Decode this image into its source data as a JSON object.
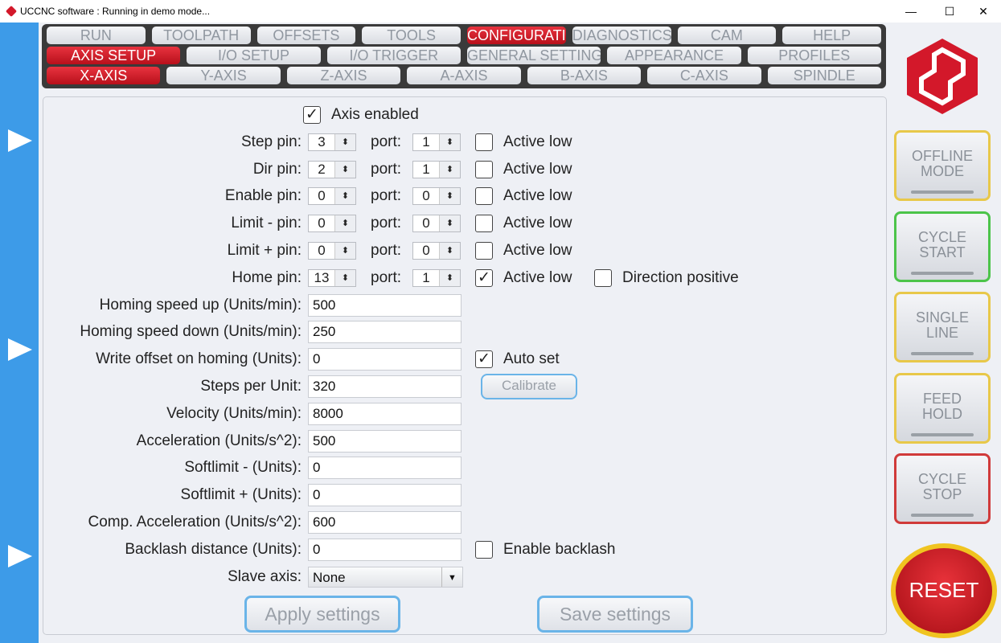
{
  "window": {
    "title": "UCCNC software : Running in demo mode...",
    "minimize": "—",
    "maximize": "☐",
    "close": "✕"
  },
  "tabs": {
    "main": [
      {
        "label": "RUN"
      },
      {
        "label": "TOOLPATH"
      },
      {
        "label": "OFFSETS"
      },
      {
        "label": "TOOLS"
      },
      {
        "label": "CONFIGURATION",
        "active": true
      },
      {
        "label": "DIAGNOSTICS"
      },
      {
        "label": "CAM"
      },
      {
        "label": "HELP"
      }
    ],
    "config": [
      {
        "label": "AXIS SETUP",
        "active": true
      },
      {
        "label": "I/O SETUP"
      },
      {
        "label": "I/O  TRIGGER"
      },
      {
        "label": "GENERAL SETTINGS"
      },
      {
        "label": "APPEARANCE"
      },
      {
        "label": "PROFILES"
      }
    ],
    "axes": [
      {
        "label": "X-AXIS",
        "active": true
      },
      {
        "label": "Y-AXIS"
      },
      {
        "label": "Z-AXIS"
      },
      {
        "label": "A-AXIS"
      },
      {
        "label": "B-AXIS"
      },
      {
        "label": "C-AXIS"
      },
      {
        "label": "SPINDLE"
      }
    ]
  },
  "form": {
    "axis_enabled": {
      "label": "Axis enabled",
      "checked": true
    },
    "port_label": "port:",
    "active_low_label": "Active low",
    "pins": [
      {
        "label": "Step pin:",
        "pin": "3",
        "port": "1",
        "active_low": false
      },
      {
        "label": "Dir pin:",
        "pin": "2",
        "port": "1",
        "active_low": false
      },
      {
        "label": "Enable pin:",
        "pin": "0",
        "port": "0",
        "active_low": false
      },
      {
        "label": "Limit - pin:",
        "pin": "0",
        "port": "0",
        "active_low": false
      },
      {
        "label": "Limit + pin:",
        "pin": "0",
        "port": "0",
        "active_low": false
      },
      {
        "label": "Home pin:",
        "pin": "13",
        "port": "1",
        "active_low": true
      }
    ],
    "direction_positive": {
      "label": "Direction positive",
      "checked": false
    },
    "fields": [
      {
        "label": "Homing speed up (Units/min):",
        "value": "500"
      },
      {
        "label": "Homing speed down (Units/min):",
        "value": "250"
      },
      {
        "label": "Write offset on homing (Units):",
        "value": "0"
      },
      {
        "label": "Steps per Unit:",
        "value": "320"
      },
      {
        "label": "Velocity (Units/min):",
        "value": "8000"
      },
      {
        "label": "Acceleration (Units/s^2):",
        "value": "500"
      },
      {
        "label": "Softlimit - (Units):",
        "value": "0"
      },
      {
        "label": "Softlimit + (Units):",
        "value": "0"
      },
      {
        "label": "Comp. Acceleration (Units/s^2):",
        "value": "600"
      },
      {
        "label": "Backlash distance (Units):",
        "value": "0"
      }
    ],
    "auto_set": {
      "label": "Auto set",
      "checked": true
    },
    "calibrate": "Calibrate",
    "enable_backlash": {
      "label": "Enable backlash",
      "checked": false
    },
    "slave_axis": {
      "label": "Slave axis:",
      "value": "None"
    },
    "apply": "Apply settings",
    "save": "Save settings"
  },
  "side": {
    "buttons": [
      {
        "label": "OFFLINE MODE",
        "color": "#e8c84a"
      },
      {
        "label": "CYCLE START",
        "color": "#4cc44a"
      },
      {
        "label": "SINGLE LINE",
        "color": "#e8c84a"
      },
      {
        "label": "FEED HOLD",
        "color": "#e8c84a"
      },
      {
        "label": "CYCLE STOP",
        "color": "#d03a3a"
      }
    ],
    "reset": "RESET"
  },
  "colors": {
    "accent": "#d3182a",
    "leftbar": "#3d9be8"
  }
}
